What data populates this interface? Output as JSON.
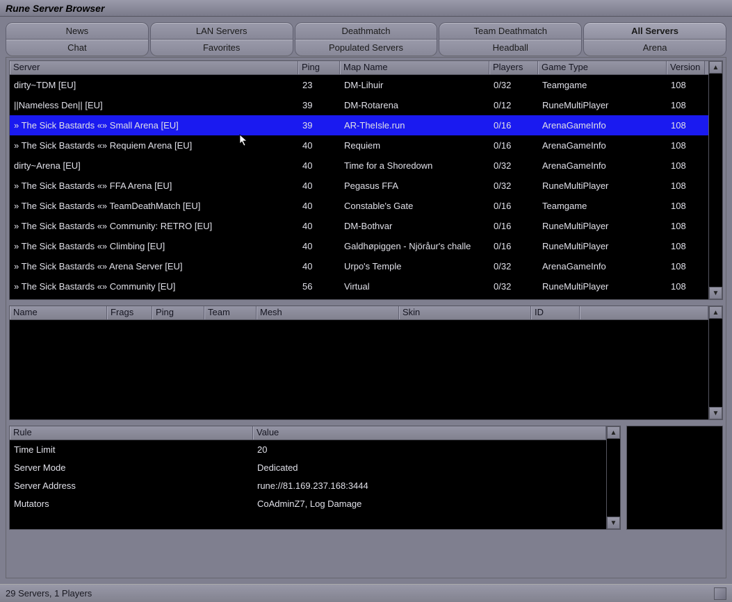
{
  "window": {
    "title": "Rune Server Browser"
  },
  "tabs_top": [
    {
      "label": "News"
    },
    {
      "label": "LAN Servers"
    },
    {
      "label": "Deathmatch"
    },
    {
      "label": "Team Deathmatch"
    },
    {
      "label": "All Servers",
      "active": true
    }
  ],
  "tabs_bottom": [
    {
      "label": "Chat"
    },
    {
      "label": "Favorites"
    },
    {
      "label": "Populated Servers"
    },
    {
      "label": "Headball"
    },
    {
      "label": "Arena"
    }
  ],
  "server_headers": {
    "server": "Server",
    "ping": "Ping",
    "map": "Map Name",
    "players": "Players",
    "game": "Game Type",
    "ver": "Version"
  },
  "servers": [
    {
      "server": "dirty~TDM [EU]",
      "ping": "23",
      "map": "DM-Lihuir",
      "players": "0/32",
      "game": "Teamgame",
      "ver": "108"
    },
    {
      "server": "||Nameless Den|| [EU]",
      "ping": "39",
      "map": "DM-Rotarena",
      "players": "0/12",
      "game": "RuneMultiPlayer",
      "ver": "108"
    },
    {
      "server": "» The Sick Bastards «» Small Arena [EU]",
      "ping": "39",
      "map": "AR-TheIsle.run",
      "players": "0/16",
      "game": "ArenaGameInfo",
      "ver": "108",
      "selected": true
    },
    {
      "server": "» The Sick Bastards «» Requiem Arena [EU]",
      "ping": "40",
      "map": "Requiem",
      "players": "0/16",
      "game": "ArenaGameInfo",
      "ver": "108"
    },
    {
      "server": "dirty~Arena [EU]",
      "ping": "40",
      "map": "Time for a Shoredown",
      "players": "0/32",
      "game": "ArenaGameInfo",
      "ver": "108"
    },
    {
      "server": "» The Sick Bastards «» FFA Arena [EU]",
      "ping": "40",
      "map": "Pegasus FFA",
      "players": "0/32",
      "game": "RuneMultiPlayer",
      "ver": "108"
    },
    {
      "server": "» The Sick Bastards «» TeamDeathMatch [EU]",
      "ping": "40",
      "map": "Constable's Gate",
      "players": "0/16",
      "game": "Teamgame",
      "ver": "108"
    },
    {
      "server": "» The Sick Bastards «» Community: RETRO [EU]",
      "ping": "40",
      "map": "DM-Bothvar",
      "players": "0/16",
      "game": "RuneMultiPlayer",
      "ver": "108"
    },
    {
      "server": "» The Sick Bastards «» Climbing [EU]",
      "ping": "40",
      "map": "Galdhøpiggen - Njöråur's challe",
      "players": "0/16",
      "game": "RuneMultiPlayer",
      "ver": "108"
    },
    {
      "server": "» The Sick Bastards «» Arena Server [EU]",
      "ping": "40",
      "map": "Urpo's Temple",
      "players": "0/32",
      "game": "ArenaGameInfo",
      "ver": "108"
    },
    {
      "server": "» The Sick Bastards «» Community [EU]",
      "ping": "56",
      "map": "Virtual",
      "players": "0/32",
      "game": "RuneMultiPlayer",
      "ver": "108"
    }
  ],
  "player_headers": {
    "name": "Name",
    "frags": "Frags",
    "ping": "Ping",
    "team": "Team",
    "mesh": "Mesh",
    "skin": "Skin",
    "id": "ID"
  },
  "rule_headers": {
    "rule": "Rule",
    "value": "Value"
  },
  "rules": [
    {
      "rule": "Time Limit",
      "value": "20"
    },
    {
      "rule": "Server Mode",
      "value": "Dedicated"
    },
    {
      "rule": "Server Address",
      "value": "rune://81.169.237.168:3444"
    },
    {
      "rule": "Mutators",
      "value": "CoAdminZ7, Log Damage"
    }
  ],
  "status": {
    "text": "29 Servers, 1 Players"
  }
}
